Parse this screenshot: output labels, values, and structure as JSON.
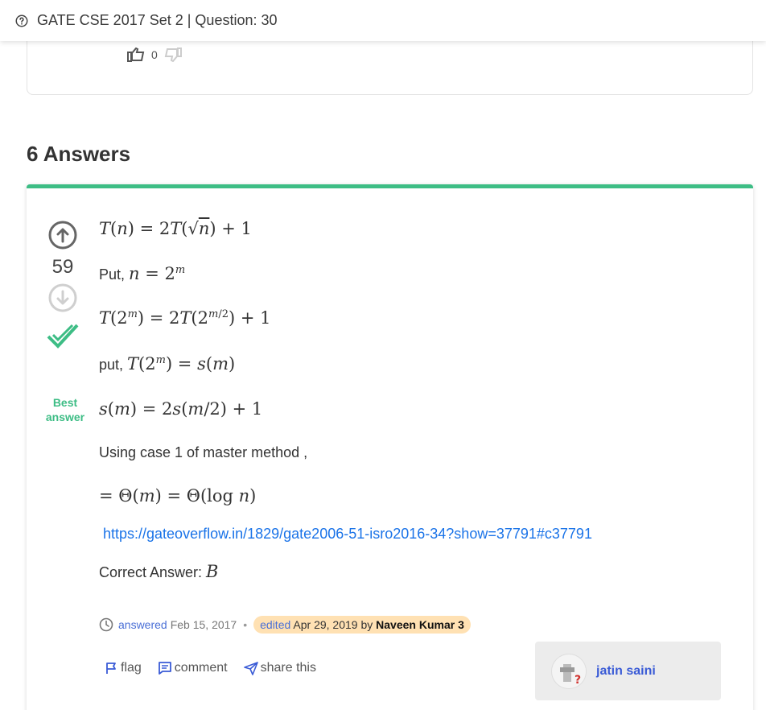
{
  "header": {
    "title": "GATE CSE 2017 Set 2 | Question: 30"
  },
  "prev_card": {
    "like_count": "0"
  },
  "answers_heading": "6 Answers",
  "answer": {
    "vote_count": "59",
    "best_label": "Best answer",
    "line_put_prefix": "Put, ",
    "line_put2_prefix": "put, ",
    "line_case": "Using case 1 of master method ,",
    "link": "https://gateoverflow.in/1829/gate2006-51-isro2016-34?show=37791#c37791",
    "correct_prefix": "Correct Answer: ",
    "correct_value": "B",
    "meta": {
      "answered_label": "answered",
      "answered_date": "Feb 15, 2017",
      "edited_label": "edited",
      "edited_date": "Apr 29, 2019 by",
      "editor": "Naveen Kumar 3"
    },
    "actions": {
      "flag": "flag",
      "comment": "comment",
      "share": "share this"
    },
    "author": "jatin saini"
  },
  "colors": {
    "accent": "#3dbd85",
    "link": "#1a73e8",
    "edited_bg": "#ffe1b3"
  }
}
